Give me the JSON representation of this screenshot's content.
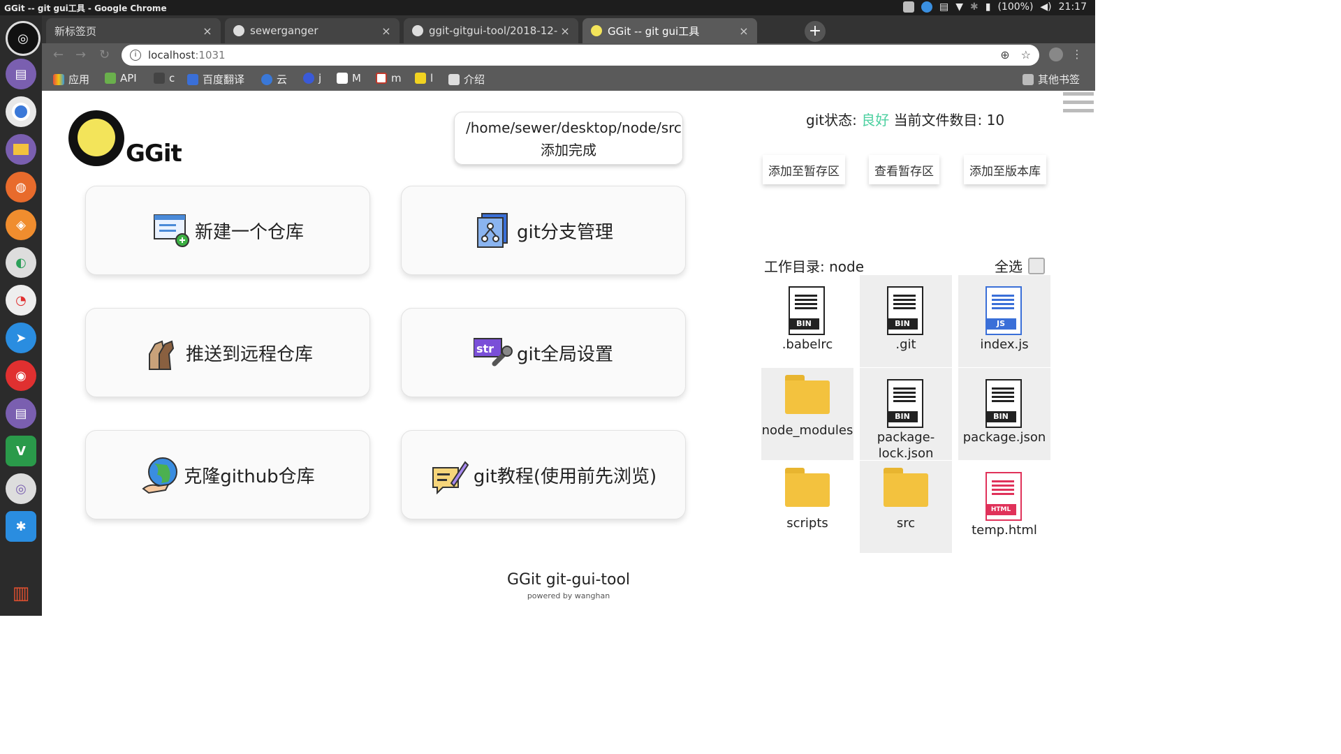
{
  "system": {
    "window_title": "GGit -- git gui工具 - Google Chrome",
    "battery": "(100%)",
    "time": "21:17"
  },
  "tabs": [
    {
      "label": "新标签页"
    },
    {
      "label": "sewerganger"
    },
    {
      "label": "ggit-gitgui-tool/2018-12-"
    },
    {
      "label": "GGit -- git gui工具"
    }
  ],
  "tab_close": "×",
  "new_tab": "+",
  "address": {
    "host": "localhost",
    "port": ":1031"
  },
  "bookmarks": [
    {
      "label": "应用",
      "color": "#e74c3c"
    },
    {
      "label": "API",
      "color": "#6ab04c"
    },
    {
      "label": "c",
      "color": "#555555"
    },
    {
      "label": "百度翻译",
      "color": "#3a6fd8"
    },
    {
      "label": "云",
      "color": "#3a78d8"
    },
    {
      "label": "j",
      "color": "#3a5ad8"
    },
    {
      "label": "M",
      "color": "#ffffff"
    },
    {
      "label": "m",
      "color": "#ffffff"
    },
    {
      "label": "l",
      "color": "#f1d321"
    },
    {
      "label": "介绍",
      "color": "#dddddd"
    }
  ],
  "other_bookmarks": "其他书签",
  "app": {
    "logo_text": "GGit",
    "message": "/home/sewer/desktop/node/src添加完成",
    "cards": [
      {
        "label": "新建一个仓库"
      },
      {
        "label": "git分支管理"
      },
      {
        "label": "推送到远程仓库"
      },
      {
        "label": "git全局设置"
      },
      {
        "label": "克隆github仓库"
      },
      {
        "label": "git教程(使用前先浏览)"
      }
    ],
    "status": {
      "git_label": "git状态:",
      "git_value": "良好",
      "count_label": "当前文件数目:",
      "count_value": "10"
    },
    "actions": {
      "add_stage": "添加至暂存区",
      "view_stage": "查看暂存区",
      "add_repo": "添加至版本库"
    },
    "workdir_label": "工作目录: node",
    "select_all": "全选",
    "files": [
      {
        "name": ".babelrc",
        "type": "BIN"
      },
      {
        "name": ".git",
        "type": "BIN"
      },
      {
        "name": "index.js",
        "type": "JS"
      },
      {
        "name": "node_modules",
        "type": "folder"
      },
      {
        "name": "package-lock.json",
        "type": "BIN"
      },
      {
        "name": "package.json",
        "type": "BIN"
      },
      {
        "name": "scripts",
        "type": "folder"
      },
      {
        "name": "src",
        "type": "folder"
      },
      {
        "name": "temp.html",
        "type": "HTML"
      }
    ],
    "footer_title": "GGit git-gui-tool",
    "footer_sub": "powered by wanghan"
  },
  "colors": {
    "good": "#4cd0a0",
    "bin_tag": "#222222",
    "js_tag": "#3a6fd8",
    "html_tag": "#e0325a"
  }
}
